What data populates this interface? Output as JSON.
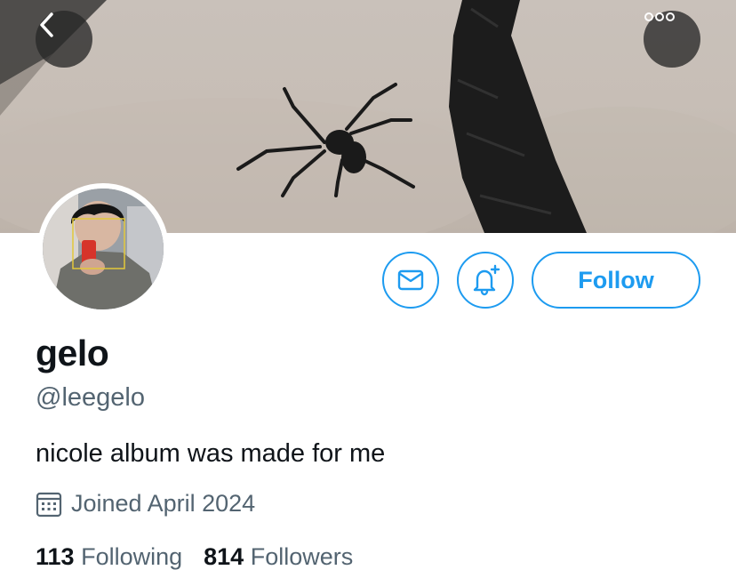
{
  "header": {
    "back_icon": "chevron-left-icon",
    "more_icon": "more-dots-icon"
  },
  "actions": {
    "message_icon": "envelope-icon",
    "notify_icon": "bell-plus-icon",
    "follow_label": "Follow"
  },
  "profile": {
    "display_name": "gelo",
    "handle": "@leegelo",
    "bio": "nicole album was made for me",
    "joined_icon": "calendar-icon",
    "joined": "Joined April 2024",
    "following_count": "113",
    "following_label": "Following",
    "followers_count": "814",
    "followers_label": "Followers"
  },
  "colors": {
    "accent": "#1d9bf0",
    "secondary_text": "#536471",
    "primary_text": "#0f1419"
  }
}
